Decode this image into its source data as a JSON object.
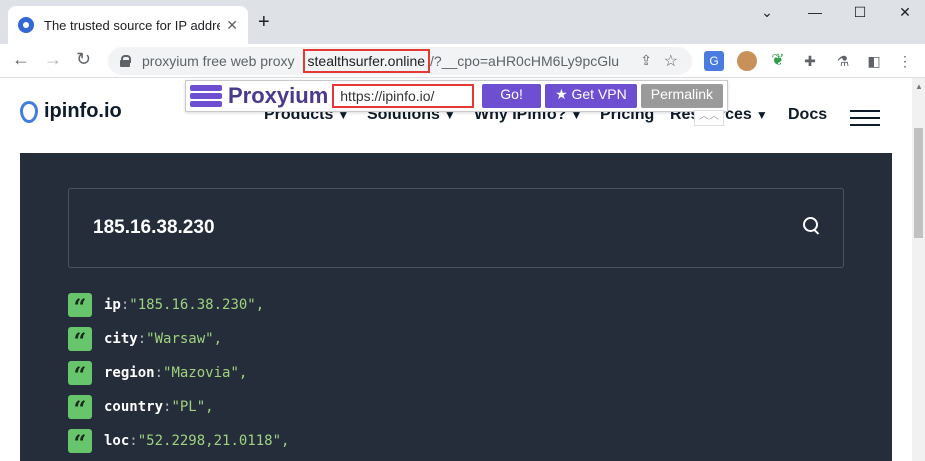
{
  "browser": {
    "tab_title": "The trusted source for IP address",
    "new_tab": "+",
    "url_prefix": "proxyium free web proxy",
    "url_host": "stealthsurfer.online",
    "url_rest": "/?__cpo=aHR0cHM6Ly9pcGlu..."
  },
  "site": {
    "logo": "ipinfo.io",
    "nav": [
      "Products",
      "Solutions",
      "Why IPinfo?",
      "Pricing",
      "Resources",
      "Docs"
    ]
  },
  "proxy": {
    "brand": "Proxyium",
    "url_value": "https://ipinfo.io/",
    "go_label": "Go!",
    "vpn_label": "★ Get VPN",
    "permalink_label": "Permalink"
  },
  "lookup": {
    "ip": "185.16.38.230",
    "fields": [
      {
        "key": "ip",
        "value": "\"185.16.38.230\","
      },
      {
        "key": "city",
        "value": "\"Warsaw\","
      },
      {
        "key": "region",
        "value": "\"Mazovia\","
      },
      {
        "key": "country",
        "value": "\"PL\","
      },
      {
        "key": "loc",
        "value": "\"52.2298,21.0118\","
      }
    ]
  }
}
